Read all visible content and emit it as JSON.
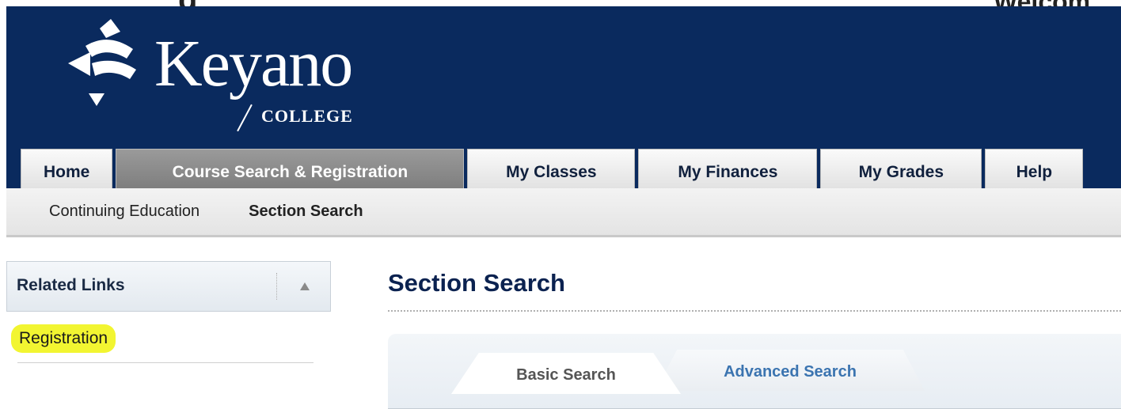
{
  "page": {
    "top_crop_left": "g",
    "top_crop_right": "Welcom"
  },
  "brand": {
    "name": "Keyano",
    "subtitle": "COLLEGE",
    "header_color": "#0a2a5e"
  },
  "main_tabs": [
    {
      "label": "Home",
      "active": false
    },
    {
      "label": "Course Search & Registration",
      "active": true
    },
    {
      "label": "My Classes",
      "active": false
    },
    {
      "label": "My Finances",
      "active": false
    },
    {
      "label": "My Grades",
      "active": false
    },
    {
      "label": "Help",
      "active": false
    }
  ],
  "subnav": [
    {
      "label": "Continuing Education",
      "current": false
    },
    {
      "label": "Section Search",
      "current": true
    }
  ],
  "related_links": {
    "title": "Related Links",
    "collapse_icon": "triangle-up-icon",
    "items": [
      {
        "label": "Registration",
        "highlighted": true,
        "highlight_color": "#f2f531"
      }
    ]
  },
  "section_search": {
    "title": "Section Search",
    "tabs": [
      {
        "label": "Basic Search",
        "active": true
      },
      {
        "label": "Advanced Search",
        "active": false
      }
    ]
  }
}
